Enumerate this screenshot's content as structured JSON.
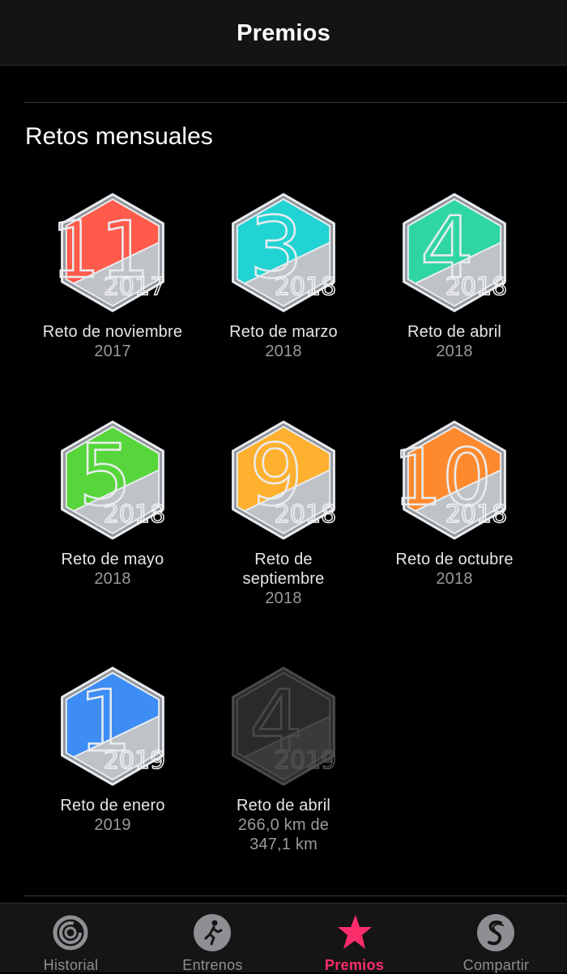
{
  "header": {
    "title": "Premios"
  },
  "section": {
    "title": "Retos mensuales"
  },
  "awards": [
    {
      "name": "Reto de noviembre",
      "sub": "2017",
      "digit": "11",
      "year": "2017",
      "color": "#ff5a4a",
      "earned": true
    },
    {
      "name": "Reto de marzo",
      "sub": "2018",
      "digit": "3",
      "year": "2018",
      "color": "#22d3d3",
      "earned": true
    },
    {
      "name": "Reto de abril",
      "sub": "2018",
      "digit": "4",
      "year": "2018",
      "color": "#2fd6a2",
      "earned": true
    },
    {
      "name": "Reto de mayo",
      "sub": "2018",
      "digit": "5",
      "year": "2018",
      "color": "#56d63a",
      "earned": true
    },
    {
      "name": "Reto de\nseptiembre",
      "sub": "2018",
      "digit": "9",
      "year": "2018",
      "color": "#ffb02e",
      "earned": true
    },
    {
      "name": "Reto de octubre",
      "sub": "2018",
      "digit": "10",
      "year": "2018",
      "color": "#ff8a2e",
      "earned": true
    },
    {
      "name": "Reto de enero",
      "sub": "2019",
      "digit": "1",
      "year": "2019",
      "color": "#3d8df5",
      "earned": true
    },
    {
      "name": "Reto de abril",
      "sub": "266,0 km de\n347,1 km",
      "digit": "4",
      "year": "2019",
      "color": "#2a2a2a",
      "earned": false
    }
  ],
  "tabs": [
    {
      "label": "Historial",
      "icon": "activity-rings-icon",
      "active": false
    },
    {
      "label": "Entrenos",
      "icon": "running-figure-icon",
      "active": false
    },
    {
      "label": "Premios",
      "icon": "star-award-icon",
      "active": true
    },
    {
      "label": "Compartir",
      "icon": "sharing-icon",
      "active": false
    }
  ],
  "colors": {
    "accent": "#fa2d6b",
    "background": "#000000"
  }
}
